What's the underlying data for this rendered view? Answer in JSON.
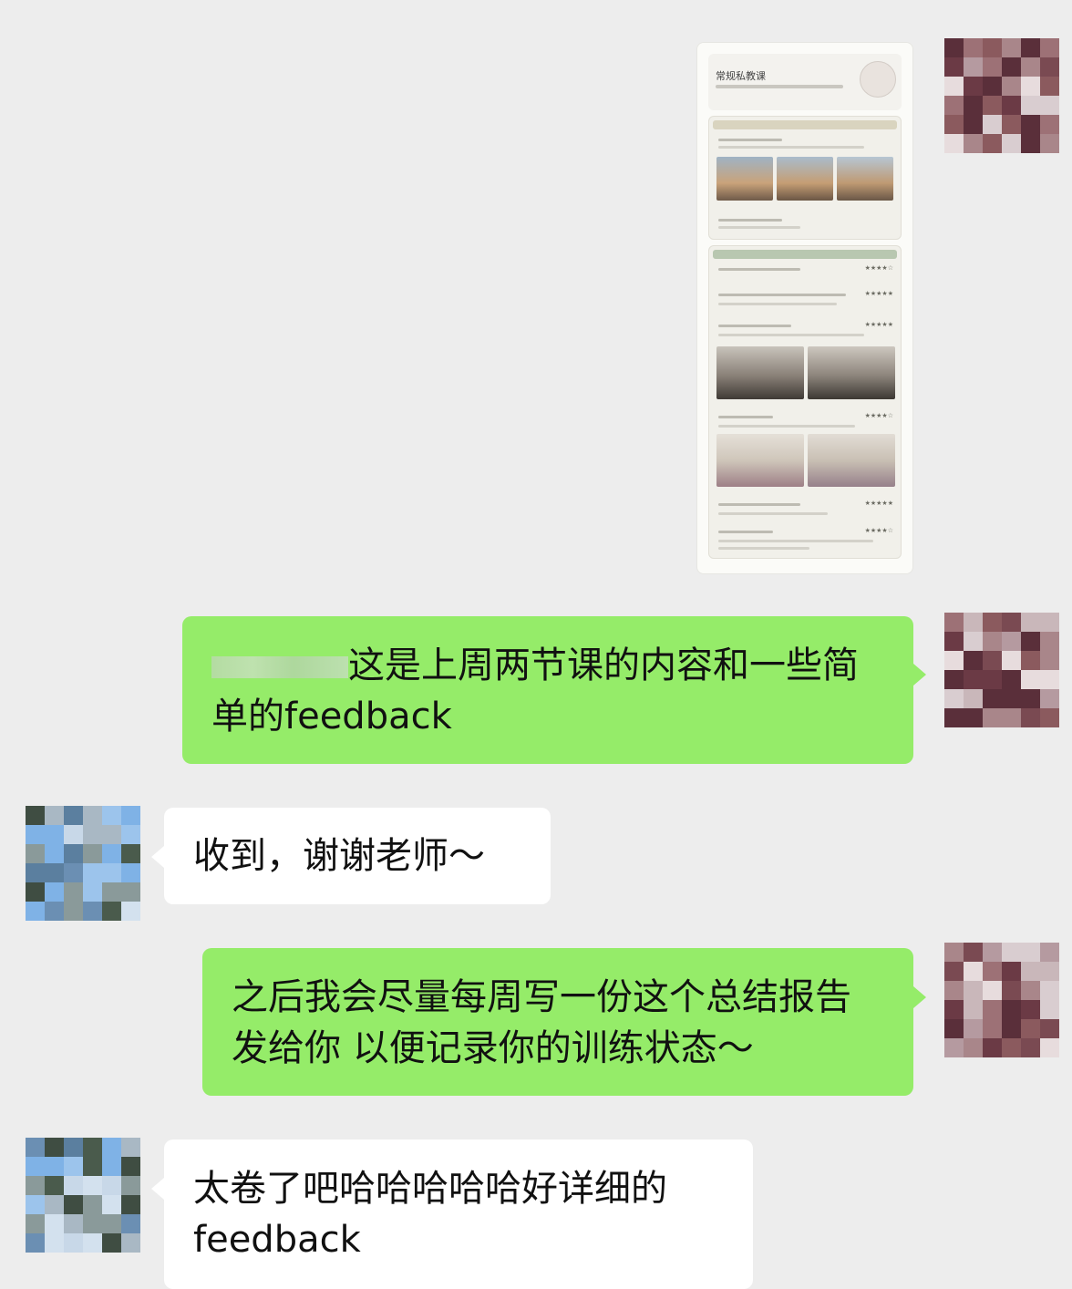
{
  "shared_report": {
    "title": "常规私教课",
    "row_stars": [
      "★★★★☆",
      "★★★★★",
      "★★★★★",
      "★★★★☆",
      "★★★★★",
      "★★★★☆"
    ]
  },
  "messages": [
    {
      "side": "right",
      "text": "这是上周两节课的内容和一些简单的feedback"
    },
    {
      "side": "left",
      "text": "收到，谢谢老师～"
    },
    {
      "side": "right",
      "text": "之后我会尽量每周写一份这个总结报告发给你 以便记录你的训练状态～"
    },
    {
      "side": "left",
      "text": "太卷了吧哈哈哈哈哈好详细的feedback"
    }
  ],
  "colors": {
    "background": "#ededed",
    "sent_bubble": "#95ec69",
    "received_bubble": "#ffffff"
  }
}
